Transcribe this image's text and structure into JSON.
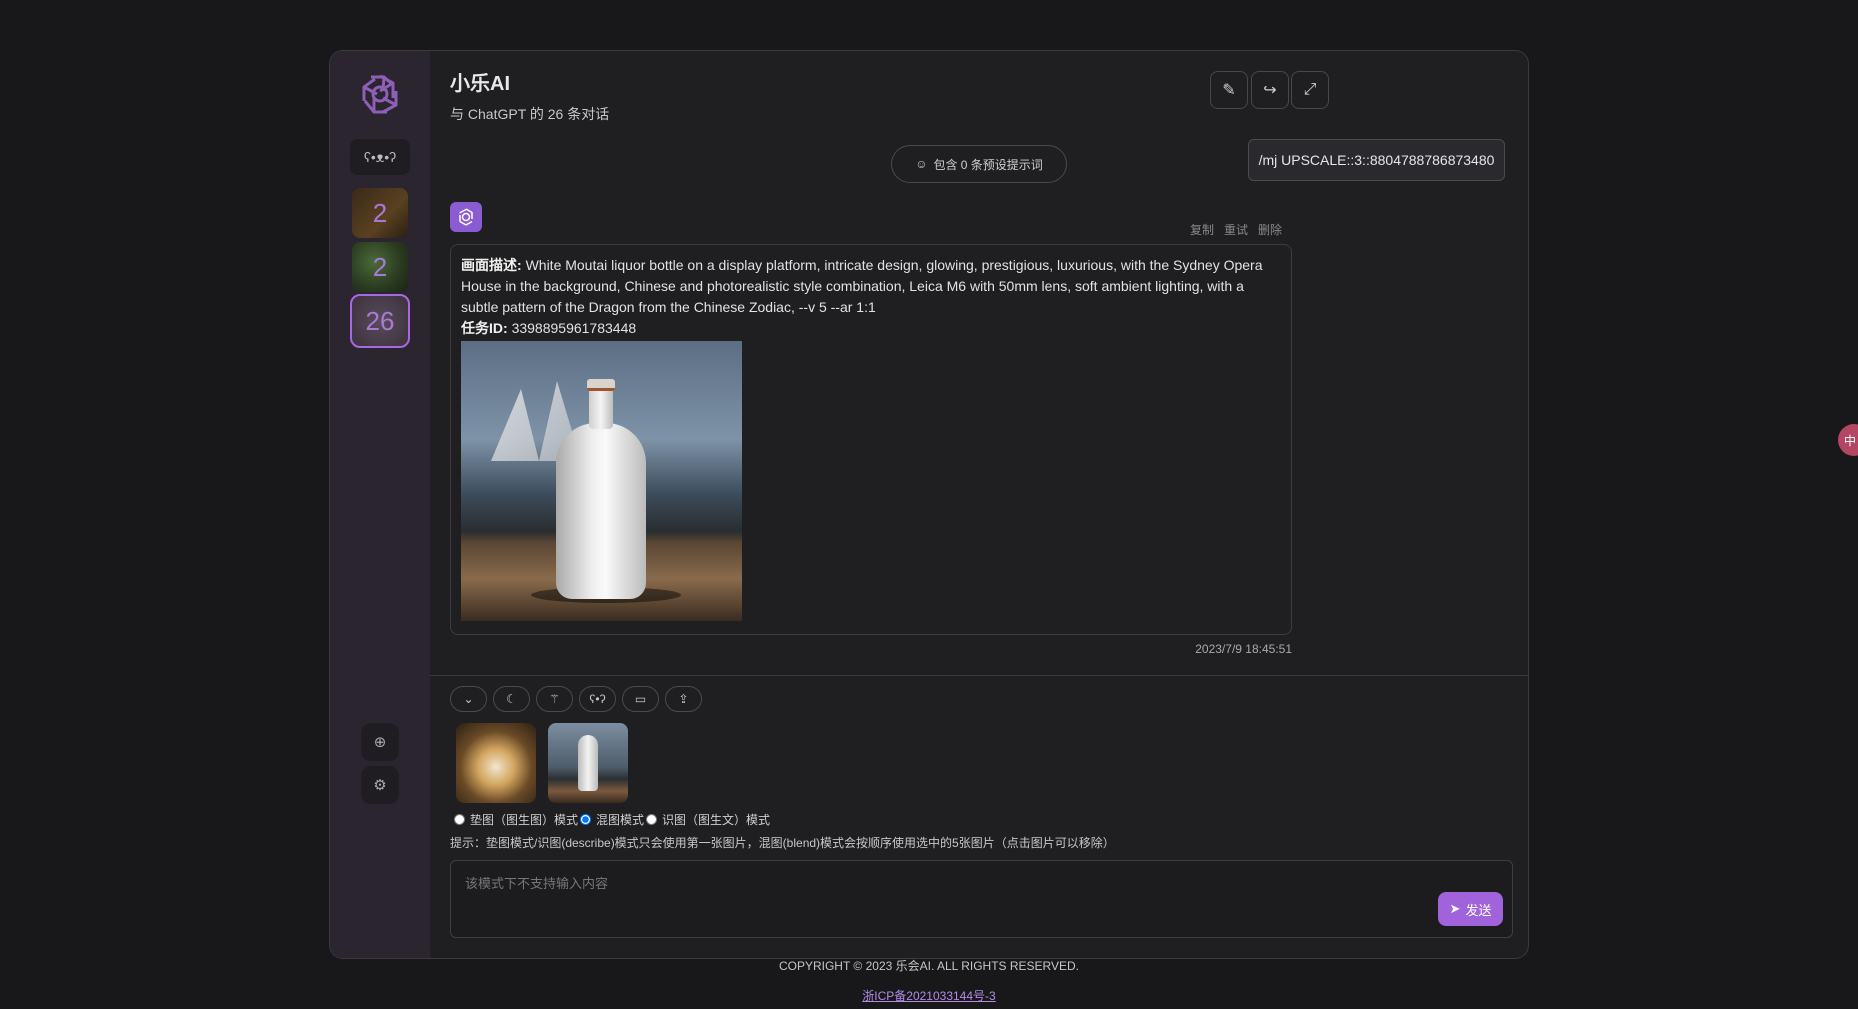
{
  "header": {
    "title": "小乐AI",
    "subtitle": "与 ChatGPT 的 26 条对话"
  },
  "sidebar": {
    "sessions": [
      {
        "count": "2"
      },
      {
        "count": "2"
      },
      {
        "count": "26"
      }
    ]
  },
  "chat": {
    "prompt_pill": "包含 0 条预设提示词",
    "user_message": "/mj UPSCALE::3::8804788786873480",
    "actions": {
      "copy": "复制",
      "retry": "重试",
      "delete": "删除"
    },
    "bot": {
      "desc_label": "画面描述:",
      "desc_text": "White Moutai liquor bottle on a display platform, intricate design, glowing, prestigious, luxurious, with the Sydney Opera House in the background, Chinese and photorealistic style combination, Leica M6 with 50mm lens, soft ambient lighting, with a subtle pattern of the Dragon from the Chinese Zodiac, --v 5 --ar 1:1",
      "task_label": "任务ID:",
      "task_id": "3398895961783448"
    },
    "timestamp": "2023/7/9 18:45:51"
  },
  "composer": {
    "modes": [
      {
        "label": "垫图（图生图）模式",
        "checked": false
      },
      {
        "label": "混图模式",
        "checked": true
      },
      {
        "label": "识图（图生文）模式",
        "checked": false
      }
    ],
    "hint": "提示：垫图模式/识图(describe)模式只会使用第一张图片，混图(blend)模式会按顺序使用选中的5张图片（点击图片可以移除）",
    "placeholder": "该模式下不支持输入内容",
    "send_label": "发送"
  },
  "footer": {
    "copyright": "COPYRIGHT © 2023 乐会AI. ALL RIGHTS RESERVED.",
    "icp": "浙ICP备2021033144号-3"
  },
  "floating_badge": "中",
  "colors": {
    "accent": "#a063dc",
    "background": "#18181a",
    "panel": "#1f1f21",
    "sidebar": "#2a252e"
  }
}
